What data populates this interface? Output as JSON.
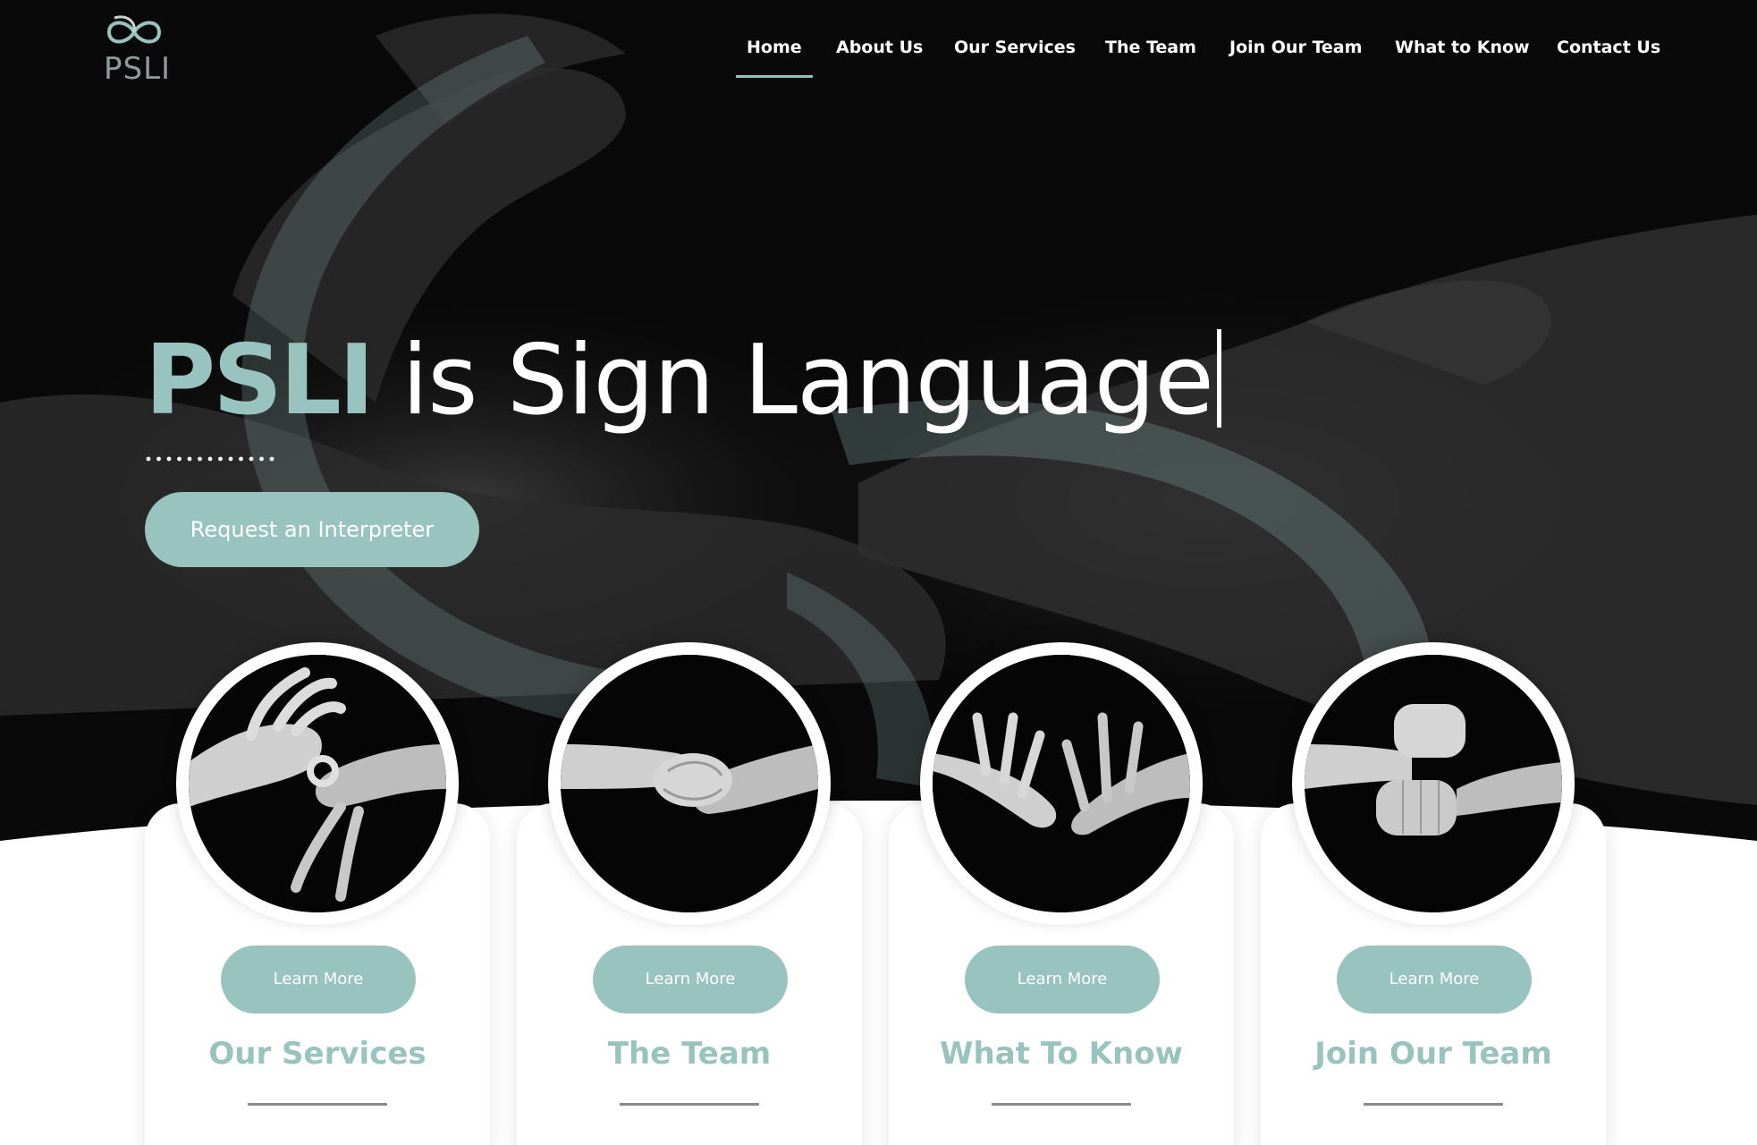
{
  "brand": {
    "logo_text": "PSLI"
  },
  "nav": {
    "items": [
      {
        "label": "Home",
        "active": true
      },
      {
        "label": "About Us",
        "active": false
      },
      {
        "label": "Our Services",
        "active": false
      },
      {
        "label": "The Team",
        "active": false
      },
      {
        "label": "Join Our Team",
        "active": false
      },
      {
        "label": "What to Know",
        "active": false
      },
      {
        "label": "Contact Us",
        "active": false
      }
    ]
  },
  "hero": {
    "headline_brand": "PSLI",
    "headline_rest": " is Sign Language",
    "cta_label": "Request an Interpreter"
  },
  "cards": [
    {
      "button_label": "Learn More",
      "title": "Our Services"
    },
    {
      "button_label": "Learn More",
      "title": "The Team"
    },
    {
      "button_label": "Learn More",
      "title": "What To Know"
    },
    {
      "button_label": "Learn More",
      "title": "Join Our Team"
    }
  ],
  "colors": {
    "accent": "#98c3bf",
    "background_dark": "#0a090a",
    "text_light": "#ffffff",
    "rule": "#8a8a8a"
  }
}
